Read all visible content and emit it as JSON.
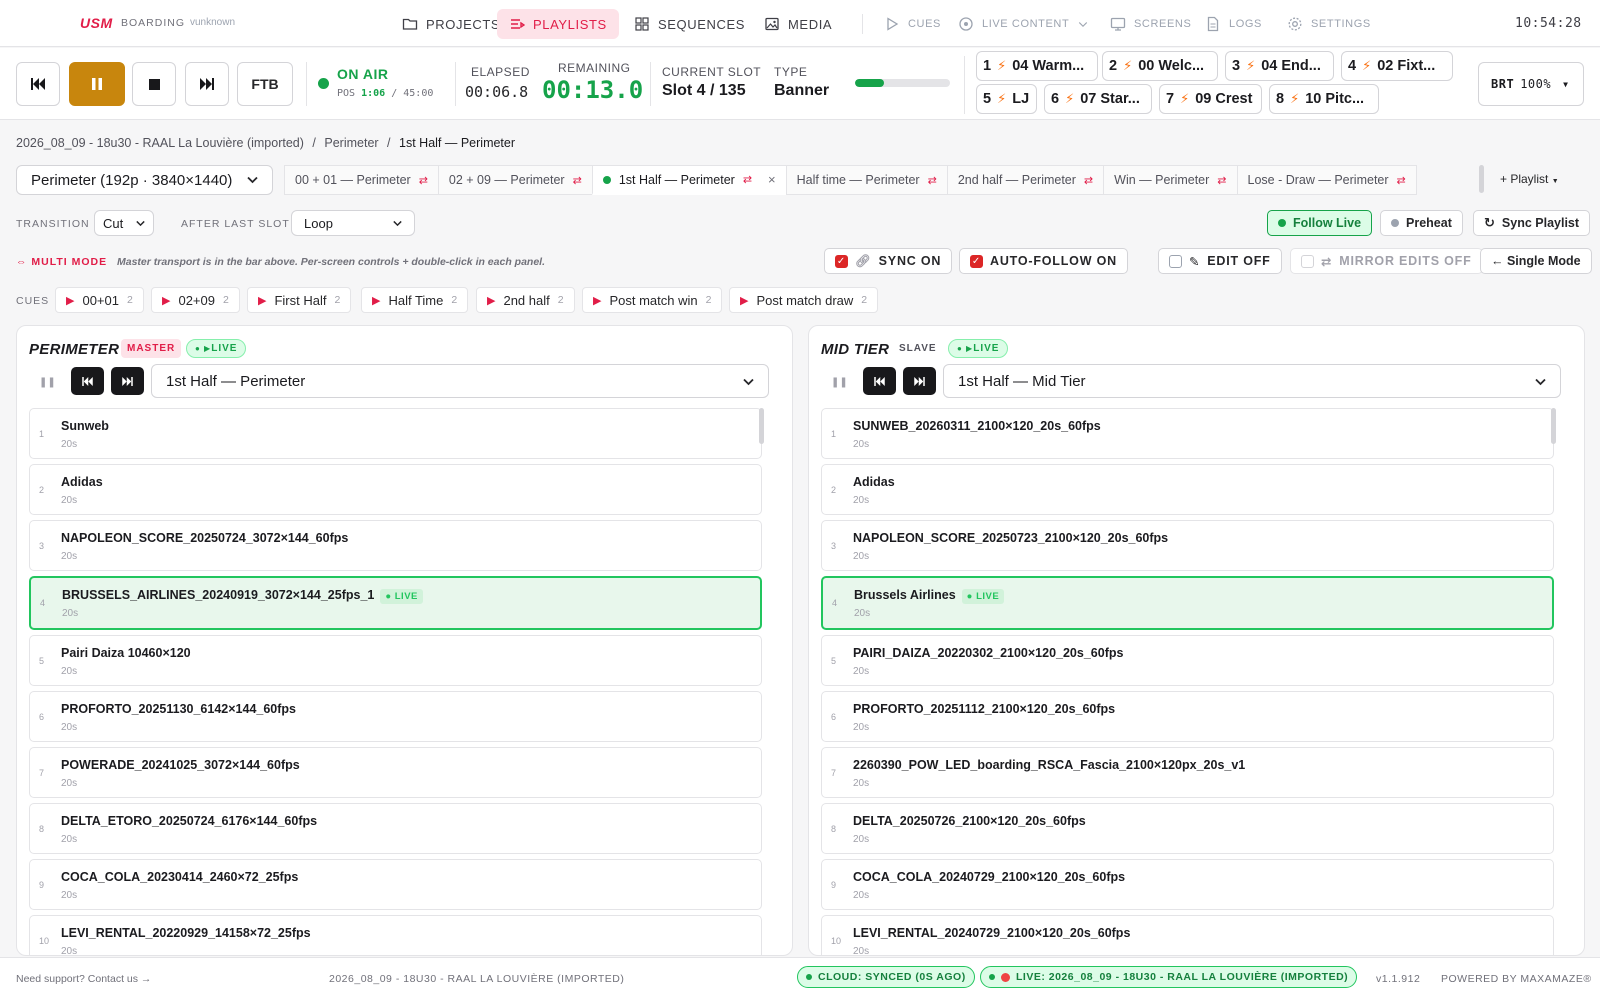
{
  "app": {
    "logo": "USM",
    "section": "BOARDING",
    "user": "vunknown",
    "clock": "10:54:28"
  },
  "nav": {
    "projects": "PROJECTS",
    "playlists": "PLAYLISTS",
    "sequences": "SEQUENCES",
    "media": "MEDIA",
    "cues": "CUES",
    "live_content": "LIVE CONTENT",
    "screens": "SCREENS",
    "logs": "LOGS",
    "settings": "SETTINGS"
  },
  "transport": {
    "ftb": "FTB",
    "on_air": "ON AIR",
    "pos_label": "POS",
    "pos_value": "1:06",
    "pos_total": "/ 45:00",
    "elapsed_label": "ELAPSED",
    "elapsed_value": "00:06.8",
    "remaining_label": "REMAINING",
    "remaining_value": "00:13.0",
    "slot_label": "CURRENT SLOT",
    "slot_value": "Slot 4 / 135",
    "type_label": "TYPE",
    "type_value": "Banner",
    "progress_fraction": 0.3,
    "quick_cues": [
      {
        "n": "1",
        "label": "04 Warm..."
      },
      {
        "n": "2",
        "label": "00 Welc..."
      },
      {
        "n": "3",
        "label": "04 End..."
      },
      {
        "n": "4",
        "label": "02 Fixt..."
      },
      {
        "n": "5",
        "label": "LJ"
      },
      {
        "n": "6",
        "label": "07 Star..."
      },
      {
        "n": "7",
        "label": "09 Crest"
      },
      {
        "n": "8",
        "label": "10 Pitc..."
      }
    ],
    "brt_label": "BRT",
    "brt_value": "100%"
  },
  "breadcrumb": {
    "project": "2026_08_09 - 18u30 - RAAL La Louvière (imported)",
    "sep": "/",
    "screen": "Perimeter",
    "playlist": "1st Half — Perimeter"
  },
  "screen_select": "Perimeter (192p · 3840×1440)",
  "playlist_tabs": [
    {
      "label": "00 + 01 — Perimeter"
    },
    {
      "label": "02 + 09 — Perimeter"
    },
    {
      "label": "1st Half — Perimeter"
    },
    {
      "label": "Half time — Perimeter"
    },
    {
      "label": "2nd half — Perimeter"
    },
    {
      "label": "Win — Perimeter"
    },
    {
      "label": "Lose - Draw — Perimeter"
    }
  ],
  "add_playlist": "+ Playlist",
  "settings": {
    "transition_label": "TRANSITION",
    "transition_value": "Cut",
    "after_label": "AFTER LAST SLOT",
    "after_value": "Loop",
    "follow_live": "Follow Live",
    "preheat": "Preheat",
    "sync_playlist": "Sync Playlist"
  },
  "multi": {
    "label": "MULTI MODE",
    "note": "Master transport is in the bar above. Per-screen controls + double-click in each panel.",
    "sync": "SYNC ON",
    "autofollow": "AUTO-FOLLOW ON",
    "edit": "EDIT OFF",
    "mirror": "MIRROR EDITS OFF",
    "single": "← Single Mode"
  },
  "cues": {
    "label": "CUES",
    "items": [
      {
        "label": "00+01",
        "count": "2"
      },
      {
        "label": "02+09",
        "count": "2"
      },
      {
        "label": "First Half",
        "count": "2"
      },
      {
        "label": "Half Time",
        "count": "2"
      },
      {
        "label": "2nd half",
        "count": "2"
      },
      {
        "label": "Post match win",
        "count": "2"
      },
      {
        "label": "Post match draw",
        "count": "2"
      }
    ]
  },
  "panels": [
    {
      "title": "PERIMETER",
      "role": "MASTER",
      "live": "LIVE",
      "playlist": "1st Half — Perimeter",
      "items": [
        {
          "i": "1",
          "name": "Sunweb",
          "dur": "20s"
        },
        {
          "i": "2",
          "name": "Adidas",
          "dur": "20s"
        },
        {
          "i": "3",
          "name": "NAPOLEON_SCORE_20250724_3072×144_60fps",
          "dur": "20s"
        },
        {
          "i": "4",
          "name": "BRUSSELS_AIRLINES_20240919_3072×144_25fps_1",
          "dur": "20s",
          "live": true
        },
        {
          "i": "5",
          "name": "Pairi Daiza 10460×120",
          "dur": "20s"
        },
        {
          "i": "6",
          "name": "PROFORTO_20251130_6142×144_60fps",
          "dur": "20s"
        },
        {
          "i": "7",
          "name": "POWERADE_20241025_3072×144_60fps",
          "dur": "20s"
        },
        {
          "i": "8",
          "name": "DELTA_ETORO_20250724_6176×144_60fps",
          "dur": "20s"
        },
        {
          "i": "9",
          "name": "COCA_COLA_20230414_2460×72_25fps",
          "dur": "20s"
        },
        {
          "i": "10",
          "name": "LEVI_RENTAL_20220929_14158×72_25fps",
          "dur": "20s"
        }
      ]
    },
    {
      "title": "MID TIER",
      "role": "SLAVE",
      "live": "LIVE",
      "playlist": "1st Half — Mid Tier",
      "items": [
        {
          "i": "1",
          "name": "SUNWEB_20260311_2100×120_20s_60fps",
          "dur": "20s"
        },
        {
          "i": "2",
          "name": "Adidas",
          "dur": "20s"
        },
        {
          "i": "3",
          "name": "NAPOLEON_SCORE_20250723_2100×120_20s_60fps",
          "dur": "20s"
        },
        {
          "i": "4",
          "name": "Brussels Airlines",
          "dur": "20s",
          "live": true
        },
        {
          "i": "5",
          "name": "PAIRI_DAIZA_20220302_2100×120_20s_60fps",
          "dur": "20s"
        },
        {
          "i": "6",
          "name": "PROFORTO_20251112_2100×120_20s_60fps",
          "dur": "20s"
        },
        {
          "i": "7",
          "name": "2260390_POW_LED_boarding_RSCA_Fascia_2100×120px_20s_v1",
          "dur": "20s"
        },
        {
          "i": "8",
          "name": "DELTA_20250726_2100×120_20s_60fps",
          "dur": "20s"
        },
        {
          "i": "9",
          "name": "COCA_COLA_20240729_2100×120_20s_60fps",
          "dur": "20s"
        },
        {
          "i": "10",
          "name": "LEVI_RENTAL_20240729_2100×120_20s_60fps",
          "dur": "20s"
        }
      ]
    }
  ],
  "footer": {
    "support": "Need support? Contact us →",
    "project": "2026_08_09 - 18U30 - RAAL LA LOUVIÈRE (IMPORTED)",
    "cloud": "CLOUD: SYNCED (0S AGO)",
    "live": "LIVE: 2026_08_09 - 18U30 - RAAL LA LOUVIÈRE (IMPORTED)",
    "version": "v1.1.912",
    "powered": "POWERED BY MAXAMAZE®"
  },
  "colors": {
    "accent": "#e11d48",
    "live": "#16a34a",
    "play": "#c8860d"
  }
}
